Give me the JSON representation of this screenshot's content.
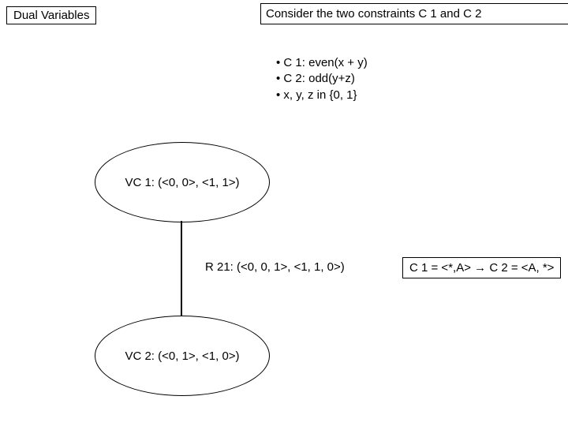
{
  "title": "Dual Variables",
  "constraints_heading": "Consider the two constraints C 1 and C 2",
  "bullets": {
    "b1": "•  C 1: even(x + y)",
    "b2": "•  C 2: odd(y+z)",
    "b3": "•  x, y, z in {0, 1}"
  },
  "nodes": {
    "vc1": "VC 1: (<0, 0>, <1, 1>)",
    "vc2": "VC 2: (<0, 1>, <1, 0>)"
  },
  "edge": {
    "r21": "R 21: (<0, 0, 1>, <1, 1, 0>)"
  },
  "mapping": {
    "left": "C 1 = <*,A>",
    "arrow": "→",
    "right": "C 2 = <A, *>"
  }
}
